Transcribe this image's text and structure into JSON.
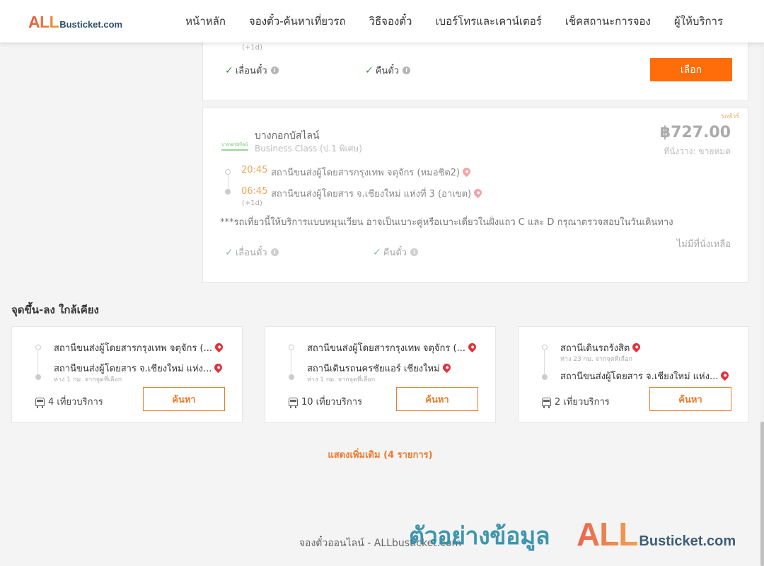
{
  "header": {
    "logo_all": "ALL",
    "logo_rest": "Busticket.com",
    "nav": [
      "หน้าหลัก",
      "จองตั๋ว-ค้นหาเที่ยวรถ",
      "วิธีจองตั๋ว",
      "เบอร์โทรและเคาน์เตอร์",
      "เช็คสถานะการจอง",
      "ผู้ให้บริการ"
    ]
  },
  "trip1": {
    "next_day": "(+1d)",
    "reschedule": "เลื่อนตั๋ว",
    "refund": "คืนตั๋ว",
    "select_label": "เลือก"
  },
  "trip2": {
    "badge": "รถทัวร์",
    "operator_logo_text": "บางกอกบัสไลน์",
    "operator": "บางกอกบัสไลน์",
    "class": "Business Class (ป.1 พิเศษ)",
    "price": "฿727.00",
    "seats": "ที่นั่งว่าง: ขายหมด",
    "depart_time": "20:45",
    "depart_station": "สถานีขนส่งผู้โดยสารกรุงเทพ จตุจักร (หมอชิต2)",
    "arrive_time": "06:45",
    "arrive_station": "สถานีขนส่งผู้โดยสาร จ.เชียงใหม่ แห่งที่ 3 (อาเขต)",
    "next_day": "(+1d)",
    "note": "***รถเที่ยวนี้ให้บริการแบบหมุนเวียน อาจเป็นเบาะคู่หรือเบาะเดี่ยวในฝั่งแถว C และ D กรุณาตรวจสอบในวันเดินทาง",
    "reschedule": "เลื่อนตั๋ว",
    "refund": "คืนตั๋ว",
    "no_seat": "ไม่มีที่นั่งเหลือ"
  },
  "nearby": {
    "title": "จุดขึ้น-ลง ใกล้เคียง",
    "cards": [
      {
        "from": "สถานีขนส่งผู้โดยสารกรุงเทพ จตุจักร (...",
        "from_dist": "",
        "to": "สถานีขนส่งผู้โดยสาร จ.เชียงใหม่ แห่ง...",
        "to_dist": "ห่าง 1 กม. จากจุดที่เลือก",
        "trips": "4 เที่ยวบริการ",
        "search": "ค้นหา"
      },
      {
        "from": "สถานีขนส่งผู้โดยสารกรุงเทพ จตุจักร (...",
        "from_dist": "",
        "to": "สถานีเดินรถนครชัยแอร์ เชียงใหม่",
        "to_dist": "ห่าง 1 กม. จากจุดที่เลือก",
        "trips": "10 เที่ยวบริการ",
        "search": "ค้นหา"
      },
      {
        "from": "สถานีเดินรถรังสิต",
        "from_dist": "ห่าง 23 กม. จากจุดที่เลือก",
        "to": "สถานีขนส่งผู้โดยสาร จ.เชียงใหม่ แห่ง...",
        "to_dist": "",
        "trips": "2 เที่ยวบริการ",
        "search": "ค้นหา"
      }
    ],
    "show_more": "แสดงเพิ่มเติม (4 รายการ)"
  },
  "footer": "จองตั๋วออนไลน์ - ALLbusticket.com",
  "watermark": {
    "text": "ตัวอย่างข้อมูล",
    "logo_all": "ALL",
    "logo_rest": "Busticket.com"
  },
  "colors": {
    "accent": "#ff6d0a",
    "price_gray": "#aaaaaa",
    "check_green": "#3a9a3a",
    "pin_red": "#e0323a"
  }
}
